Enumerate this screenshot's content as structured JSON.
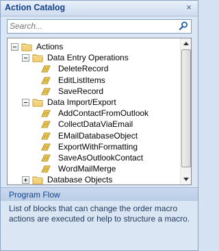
{
  "title": "Action Catalog",
  "close_glyph": "×",
  "search": {
    "placeholder": "Search...",
    "icon": "search-icon"
  },
  "tree": {
    "root": {
      "label": "Actions",
      "expanded": true
    },
    "groups": [
      {
        "label": "Data Entry Operations",
        "expanded": true,
        "items": [
          "DeleteRecord",
          "EditListItems",
          "SaveRecord"
        ]
      },
      {
        "label": "Data Import/Export",
        "expanded": true,
        "items": [
          "AddContactFromOutlook",
          "CollectDataViaEmail",
          "EMailDatabaseObject",
          "ExportWithFormatting",
          "SaveAsOutlookContact",
          "WordMailMerge"
        ]
      },
      {
        "label": "Database Objects",
        "expanded": false,
        "items": []
      }
    ]
  },
  "program_flow": {
    "label": "Program Flow",
    "description": "List of blocks that can change the order macro actions are executed or help to structure a macro."
  },
  "colors": {
    "folder": "#f3d27a",
    "macro": "#e8c24a",
    "header": "#15428b"
  }
}
